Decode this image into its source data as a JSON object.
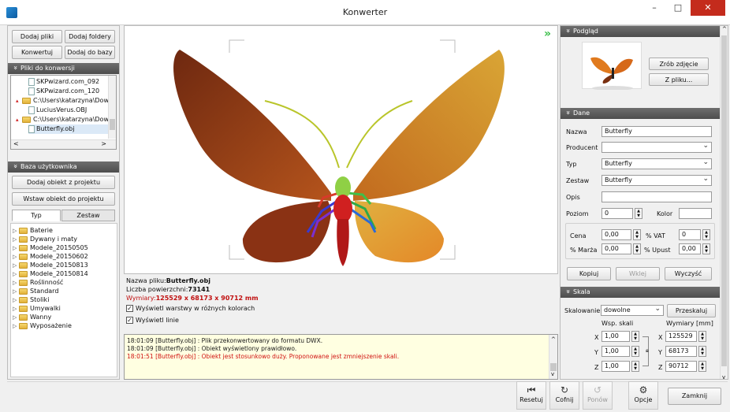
{
  "window": {
    "title": "Konwerter",
    "minimize": "–",
    "maximize": "□",
    "close": "✕"
  },
  "left": {
    "buttons": {
      "add_files": "Dodaj pliki",
      "add_folders": "Dodaj foldery",
      "convert": "Konwertuj",
      "add_to_base": "Dodaj do bazy"
    },
    "files_header": "Pliki do konwersji",
    "files": [
      {
        "text": "SKPwizard.com_092",
        "type": "file",
        "indent": 1
      },
      {
        "text": "SKPwizard.com_120",
        "type": "file",
        "indent": 1
      },
      {
        "text": "C:\\Users\\katarzyna\\Dow",
        "type": "folder",
        "indent": 0
      },
      {
        "text": "LuciusVerus.OBJ",
        "type": "file",
        "indent": 1
      },
      {
        "text": "C:\\Users\\katarzyna\\Dow",
        "type": "folder",
        "indent": 0
      },
      {
        "text": "Butterfly.obj",
        "type": "file",
        "indent": 1
      }
    ],
    "user_base_header": "Baza użytkownika",
    "add_obj_from_project": "Dodaj obiekt z projektu",
    "insert_obj_to_project": "Wstaw obiekt do projektu",
    "tabs": [
      "Typ",
      "Zestaw"
    ],
    "tree": [
      "Baterie",
      "Dywany i maty",
      "Modele_20150505",
      "Modele_20150602",
      "Modele_20150813",
      "Modele_20150814",
      "Roślinność",
      "Standard",
      "Stoliki",
      "Umywalki",
      "Wanny",
      "Wyposażenie"
    ]
  },
  "info": {
    "filename_label": "Nazwa pliku:",
    "filename_value": "Butterfly.obj",
    "surfaces_label": "Liczba powierzchni:",
    "surfaces_value": "73141",
    "dims_label": "Wymiary:",
    "dims_value": "125529 x 68173 x 90712 mm",
    "layers_checkbox": "Wyświetl warstwy w różnych kolorach",
    "lines_checkbox": "Wyświetl linie"
  },
  "log": [
    {
      "text": "18:01:09 [Butterfly.obj] : Plik przekonwertowany do formatu DWX.",
      "color": "#1a1a1a"
    },
    {
      "text": "18:01:09 [Butterfly.obj] : Obiekt wyświetlony prawidłowo.",
      "color": "#1a1a1a"
    },
    {
      "text": "18:01:51 [Butterfly.obj] : Obiekt jest stosunkowo duży. Proponowane jest zmniejszenie skali.",
      "color": "#d01010"
    }
  ],
  "right": {
    "preview_header": "Podgląd",
    "take_photo": "Zrób zdjęcie",
    "from_file": "Z pliku...",
    "data_header": "Dane",
    "name_label": "Nazwa",
    "name_value": "Butterfly",
    "producer_label": "Producent",
    "producer_value": "",
    "type_label": "Typ",
    "type_value": "Butterfly",
    "set_label": "Zestaw",
    "set_value": "Butterfly",
    "desc_label": "Opis",
    "desc_value": "",
    "level_label": "Poziom",
    "level_value": "0",
    "color_label": "Kolor",
    "price_label": "Cena",
    "price_value": "0,00",
    "vat_label": "% VAT",
    "vat_value": "0",
    "margin_label": "% Marża",
    "margin_value": "0,00",
    "discount_label": "% Upust",
    "discount_value": "0,00",
    "copy": "Kopiuj",
    "paste": "Wklej",
    "clear": "Wyczyść",
    "scale_header": "Skala",
    "scaling_label": "Skalowanie",
    "scaling_value": "dowolne",
    "rescale": "Przeskaluj",
    "scale_coef_label": "Wsp. skali",
    "dims_mm_label": "Wymiary [mm]",
    "sx": "1,00",
    "sy": "1,00",
    "sz": "1,00",
    "dx": "125529",
    "dy": "68173",
    "dz": "90712",
    "x": "X",
    "y": "Y",
    "z": "Z"
  },
  "toolbar": {
    "reset": "Resetuj",
    "undo": "Cofnij",
    "redo": "Ponów",
    "options": "Opcje",
    "close": "Zamknij"
  }
}
